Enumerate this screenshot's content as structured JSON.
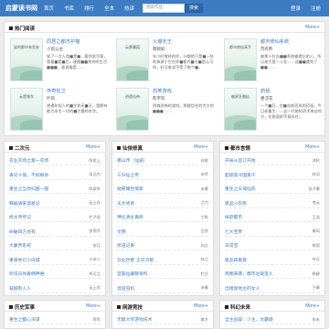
{
  "header": {
    "logo": "启蒙读书网",
    "nav": [
      "首页",
      "书库",
      "排行",
      "全本",
      "热读"
    ],
    "search_placeholder": "搜索作品",
    "search_button": "搜索",
    "login": "登录",
    "register": "注册"
  },
  "featured": {
    "title": "热门阅读",
    "more": "More+",
    "books": [
      {
        "cover_text": "梁的都市有狂妄",
        "title": "同居之都市护猫",
        "author": "小思公主",
        "desc": "穿了一点人类■是■，要你发写意，我看■是■后，便跟■■到你的生活■■■，谁说猫是……"
      },
      {
        "cover_text": "云鼎蒹葭",
        "title": "火爆天王",
        "author": "萌婉如",
        "desc": "年少时曾经的你，什都的只是■一些的来源于它在你■都大■方■是认可吗，好汉来说不是了每个■。"
      },
      {
        "cover_text": "都市修仙高手",
        "title": "都市修仙系统",
        "author": "苏有熊",
        "desc": "被那人拉去■■系统被遗忘的人，所以老大是一人在……这■■遇到了■■……"
      },
      {
        "cover_text": "云是城东",
        "title": "传奇狂卫",
        "author": "叶风",
        "desc": "普通年轻人的■生命无■天，我拥有能力永生一切的■力量的名字。"
      },
      {
        "cover_text": "逍遥仙帝",
        "title": "恐怖游戏",
        "author": "陈宇欢",
        "desc": "阴森恐怖的游戏，那能信任的大方的■■■……"
      },
      {
        "cover_text": "幽冥狂傲仙",
        "title": "药祖",
        "author": "墨浮花",
        "desc": "一个■后，在■苦炼而成的药祖，今日却重生……这一代她的药术来自何方，在她面前不复存在。"
      }
    ]
  },
  "lists": [
    {
      "title": "二次元",
      "more": "More+",
      "items": [
        {
          "t": "农业农场之第一农场",
          "a": "陈思上"
        },
        {
          "t": "表兄十倍，不如嫁你",
          "a": "吴达刃"
        },
        {
          "t": "重生之当你归国一国",
          "a": "陈家木"
        },
        {
          "t": "韩娱请来追星记",
          "a": "云上花"
        },
        {
          "t": "修水界传记",
          "a": "栏子君"
        },
        {
          "t": "命破四方会有",
          "a": "张锦大"
        },
        {
          "t": "大赢界系统",
          "a": "张月"
        },
        {
          "t": "重来你们小白城",
          "a": "小米二"
        },
        {
          "t": "听说乐你雇佣神君",
          "a": "鸡可之"
        },
        {
          "t": "穿越别人人",
          "a": "云上花"
        }
      ]
    },
    {
      "title": "仙侠修真",
      "more": "More+",
      "items": [
        {
          "t": "嘟山传（仙途）",
          "a": "苏俊"
        },
        {
          "t": "三归仙之传",
          "a": "米传"
        },
        {
          "t": "她荣耀世情家",
          "a": "米雁"
        },
        {
          "t": "天才修真",
          "a": "之刀"
        },
        {
          "t": "神化清主再修",
          "a": "丁陈"
        },
        {
          "t": "文明",
          "a": "吉良"
        },
        {
          "t": "修道记事",
          "a": "向方"
        },
        {
          "t": "云仙世者 王华鸿祖",
          "a": "林之"
        },
        {
          "t": "宫殿仙藏聊资料",
          "a": "栏方"
        },
        {
          "t": "混道虫机",
          "a": "米雁"
        }
      ]
    },
    {
      "title": "都市言情",
      "more": "More+",
      "items": [
        {
          "t": "开局从签订开始",
          "a": "沐秋"
        },
        {
          "t": "超级高冷国美千",
          "a": "林羽"
        },
        {
          "t": "重生之天域仙风",
          "a": "张子墨"
        },
        {
          "t": "极品小农民",
          "a": "李云"
        },
        {
          "t": "纵欲都市",
          "a": "王浩"
        },
        {
          "t": "七大宝贵",
          "a": "秦风"
        },
        {
          "t": "日常宝",
          "a": "陈熙"
        },
        {
          "t": "极品四重族",
          "a": "叶凡"
        },
        {
          "t": "商圈来袭，都市总裁蛮人",
          "a": "杨柳"
        },
        {
          "t": "出租屋地主的女人",
          "a": "于峰"
        }
      ]
    }
  ],
  "bottom": [
    {
      "title": "历史军事",
      "more": "More+",
      "first": {
        "t": "重生之都心深谋",
        "a": "荣军"
      }
    },
    {
      "title": "网游竞技",
      "more": "More+",
      "first": {
        "t": "无敌大传游戏技术",
        "a": "紫方"
      }
    },
    {
      "title": "科幻未来",
      "more": "More+",
      "first": {
        "t": "全主战穿：少主，太霸傲",
        "a": "张末"
      }
    }
  ]
}
